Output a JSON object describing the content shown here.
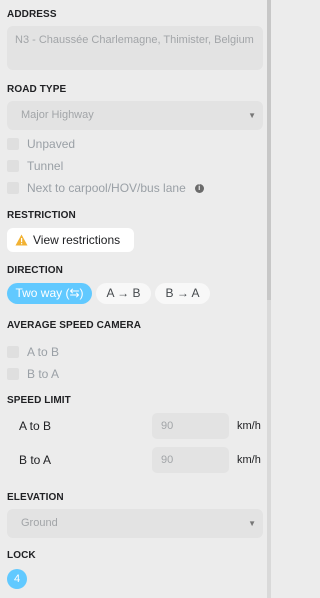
{
  "address": {
    "label": "ADDRESS",
    "value": "N3 - Chaussée Charlemagne, Thimister, Belgium"
  },
  "road_type": {
    "label": "ROAD TYPE",
    "selected": "Major Highway",
    "checkboxes": {
      "unpaved": "Unpaved",
      "tunnel": "Tunnel",
      "carpool": "Next to carpool/HOV/bus lane"
    }
  },
  "restriction": {
    "label": "RESTRICTION",
    "button": "View restrictions"
  },
  "direction": {
    "label": "DIRECTION",
    "options": [
      "Two way (⇆)",
      "A → B",
      "B → A"
    ],
    "active": "Two way (⇆)"
  },
  "speed_camera": {
    "label": "AVERAGE SPEED CAMERA",
    "a_to_b": "A to B",
    "b_to_a": "B to A"
  },
  "speed_limit": {
    "label": "SPEED LIMIT",
    "rows": [
      {
        "label": "A to B",
        "value": "90",
        "unit": "km/h"
      },
      {
        "label": "B to A",
        "value": "90",
        "unit": "km/h"
      }
    ]
  },
  "elevation": {
    "label": "ELEVATION",
    "selected": "Ground"
  },
  "lock": {
    "label": "LOCK",
    "value": "4"
  },
  "colors": {
    "accent": "#61c9ff",
    "background": "#ececec",
    "field": "#e3e3e3"
  },
  "icons": [
    "caret-down-icon",
    "info-icon",
    "warning-icon"
  ]
}
